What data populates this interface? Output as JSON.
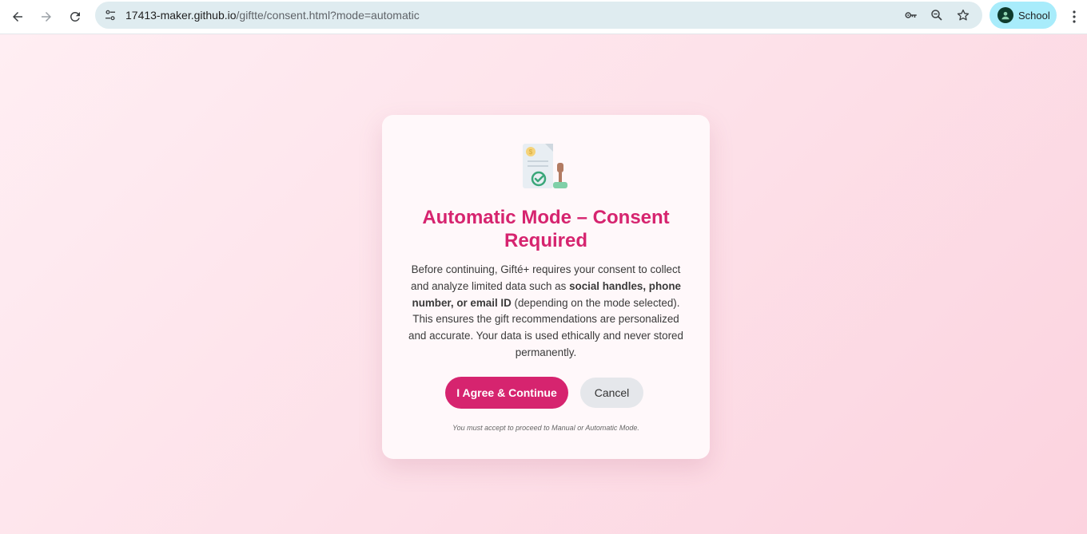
{
  "browser": {
    "url_host": "17413-maker.github.io",
    "url_path": "/giftte/consent.html?mode=automatic",
    "profile_label": "School",
    "icons": {
      "back": "arrow-left-icon",
      "forward": "arrow-right-icon",
      "reload": "reload-icon",
      "site_info": "tune-icon",
      "password": "key-icon",
      "zoom": "zoom-icon",
      "bookmark": "star-icon",
      "menu": "kebab-menu-icon"
    }
  },
  "consent": {
    "icon": "document-stamp-icon",
    "title": "Automatic Mode – Consent Required",
    "body_intro": "Before continuing, Gifté+ requires your consent to collect and analyze limited data such as ",
    "body_bold": "social handles, phone number, or email ID",
    "body_outro": " (depending on the mode selected). This ensures the gift recommendations are personalized and accurate. Your data is used ethically and never stored permanently.",
    "agree_label": "I Agree & Continue",
    "cancel_label": "Cancel",
    "note": "You must accept to proceed to Manual or Automatic Mode."
  },
  "colors": {
    "accent": "#d6246f",
    "page_bg_start": "#ffeef3",
    "page_bg_end": "#fcd3df",
    "card_bg": "#fff8fa",
    "cancel_bg": "#e5e7eb",
    "omnibox_bg": "#dfecf0",
    "profile_chip_bg": "#a8ecfb"
  }
}
